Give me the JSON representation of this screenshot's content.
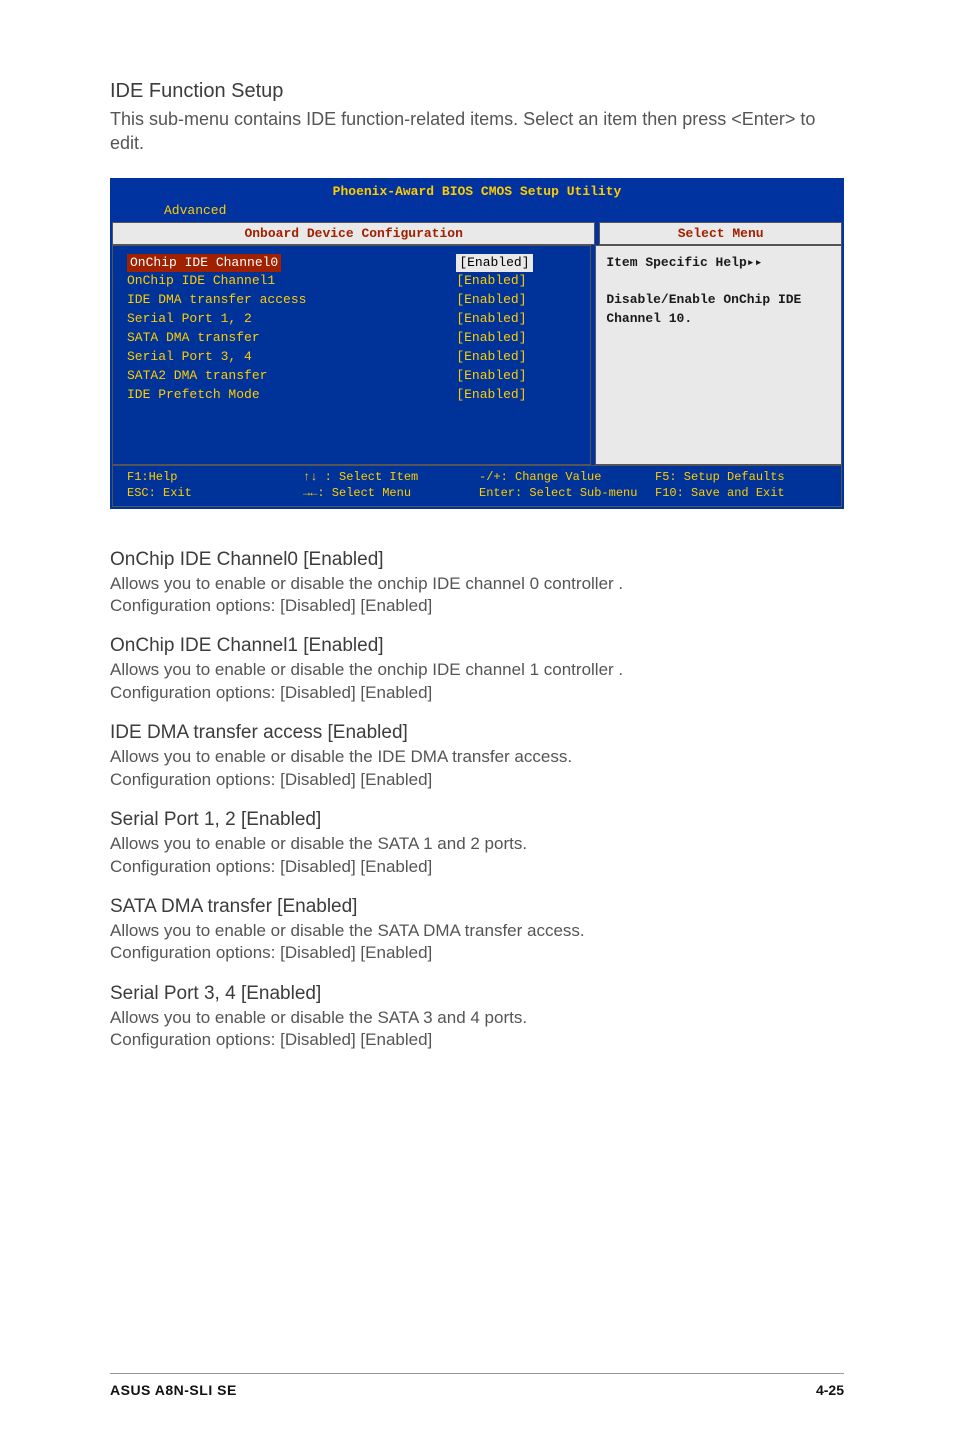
{
  "section_title": "IDE Function Setup",
  "section_lead": "This sub-menu contains IDE function-related items. Select an item then press <Enter> to edit.",
  "bios": {
    "title": "Phoenix-Award BIOS CMOS Setup Utility",
    "tab": "Advanced",
    "panel_title_left": "Onboard Device Configuration",
    "panel_title_right": "Select Menu",
    "rows": [
      {
        "label": "OnChip IDE Channel0",
        "value": "[Enabled]",
        "selected": true
      },
      {
        "label": "OnChip IDE Channel1",
        "value": "[Enabled]"
      },
      {
        "label": "IDE DMA transfer access",
        "value": "[Enabled]"
      },
      {
        "label": "Serial Port 1, 2",
        "value": "[Enabled]"
      },
      {
        "label": "SATA DMA transfer",
        "value": "[Enabled]"
      },
      {
        "label": "Serial Port 3, 4",
        "value": "[Enabled]"
      },
      {
        "label": "SATA2 DMA transfer",
        "value": "[Enabled]"
      },
      {
        "label": "IDE Prefetch Mode",
        "value": "[Enabled]"
      }
    ],
    "help_title": "Item Specific Help▸▸",
    "help_body1": "Disable/Enable OnChip IDE",
    "help_body2": "Channel 10.",
    "footer": {
      "c1a": "F1:Help",
      "c1b": "ESC: Exit",
      "c2a": "↑↓ : Select Item",
      "c2b": "→←: Select Menu",
      "c3a": "-/+: Change Value",
      "c3b": "Enter: Select Sub-menu",
      "c4a": "F5: Setup Defaults",
      "c4b": "F10: Save and Exit"
    }
  },
  "items": [
    {
      "h": "OnChip IDE Channel0 [Enabled]",
      "p1": "Allows you to enable or disable the onchip IDE channel 0 controller .",
      "p2": "Configuration options: [Disabled] [Enabled]"
    },
    {
      "h": "OnChip IDE Channel1 [Enabled]",
      "p1": "Allows you to enable or disable the onchip IDE channel 1 controller .",
      "p2": "Configuration options: [Disabled] [Enabled]"
    },
    {
      "h": "IDE DMA transfer access [Enabled]",
      "p1": "Allows you to enable or disable the IDE DMA transfer access.",
      "p2": "Configuration options: [Disabled] [Enabled]"
    },
    {
      "h": "Serial Port 1, 2 [Enabled]",
      "p1": "Allows you to enable or disable the SATA 1 and 2 ports.",
      "p2": "Configuration options: [Disabled] [Enabled]"
    },
    {
      "h": "SATA DMA transfer [Enabled]",
      "p1": "Allows you to enable or disable the SATA DMA transfer access.",
      "p2": "Configuration options: [Disabled] [Enabled]"
    },
    {
      "h": "Serial Port 3, 4 [Enabled]",
      "p1": "Allows you to enable or disable the SATA 3 and 4 ports.",
      "p2": "Configuration options: [Disabled] [Enabled]"
    }
  ],
  "footer_left": "ASUS A8N-SLI SE",
  "footer_right": "4-25"
}
